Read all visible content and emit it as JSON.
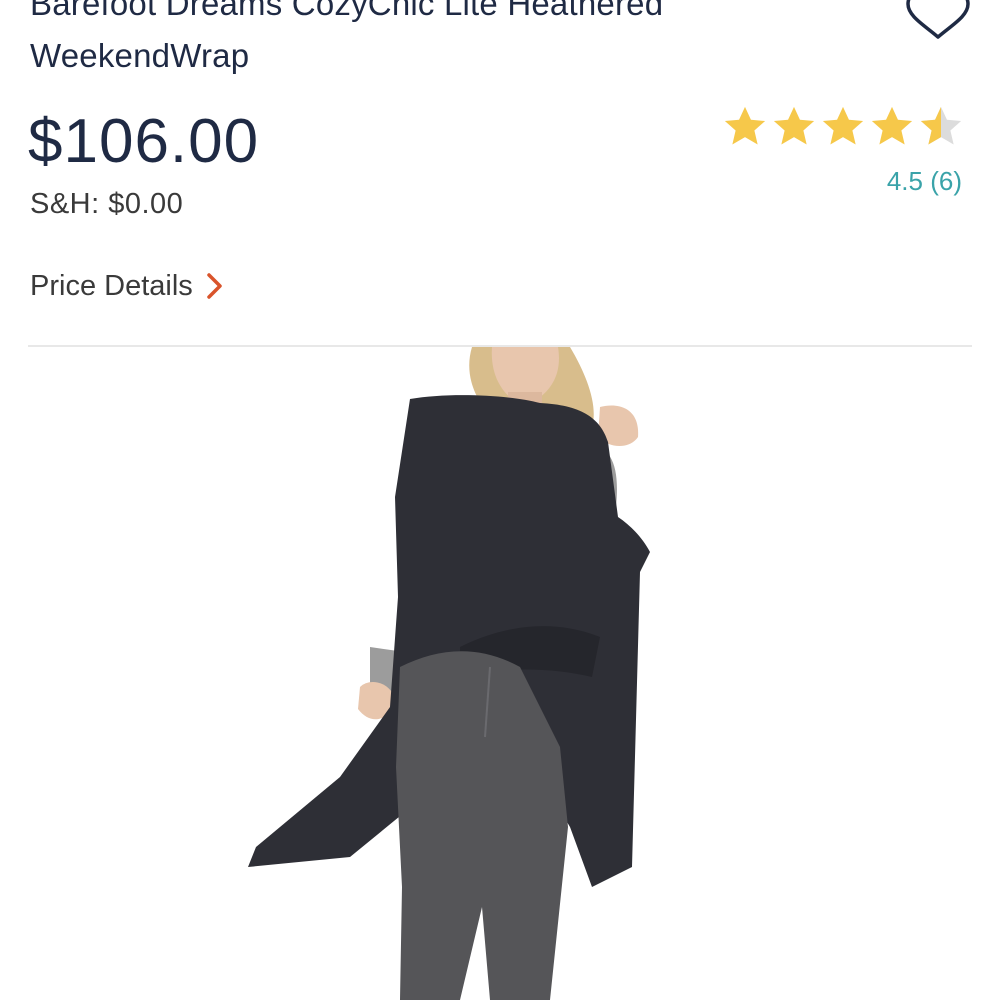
{
  "product": {
    "title_line1": "Barefoot Dreams CozyChic Lite Heathered",
    "title_line2": "WeekendWrap",
    "price": "$106.00",
    "shipping": "S&H: $0.00",
    "price_details_label": "Price Details",
    "rating_value": 4.5,
    "rating_text": "4.5 (6)",
    "rating_max": 5
  },
  "icons": {
    "favorite": "heart-outline-icon",
    "price_details_chevron": "chevron-right-icon",
    "star": "star-icon"
  },
  "colors": {
    "title": "#1f2a44",
    "price": "#1f2a44",
    "star_filled": "#f6c84a",
    "star_empty": "#dcdcdc",
    "rating_text": "#3aa3a9",
    "chevron": "#d9542b",
    "heart": "#1f2a44"
  }
}
